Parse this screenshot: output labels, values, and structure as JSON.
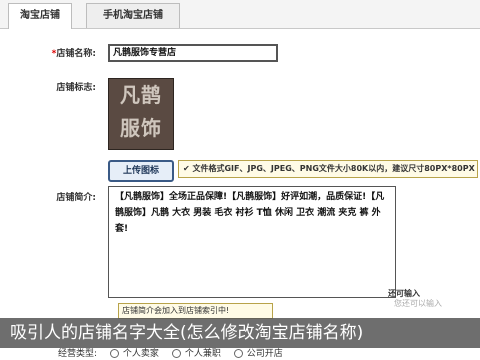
{
  "tabs": [
    {
      "label": "淘宝店铺"
    },
    {
      "label": "手机淘宝店铺"
    }
  ],
  "form": {
    "name_label": "店铺名称:",
    "name_value": "凡鹊服饰专营店",
    "logo_label": "店铺标志:",
    "logo_line1": "凡鹊",
    "logo_line2": "服饰",
    "upload_label": "上传图标",
    "upload_tip": "✔ 文件格式GIF、JPG、JPEG、PNG文件大小80K以内，建议尺寸80PX*80PX",
    "intro_label": "店铺简介:",
    "intro_text": "【凡鹊服饰】全场正品保障!【凡鹊服饰】好评如潮，品质保证!【凡鹊服饰】凡鹊 大衣 男装 毛衣 衬衫 T恤 休闲 卫衣 潮流 夹克 裤 外套!",
    "count_text": "还可输入",
    "hint_text": "您还可以输入",
    "promo_text": "店铺简介会加入到店铺索引中!",
    "type_label": "经营类型:",
    "type_options": [
      "个人卖家",
      "个人兼职",
      "公司开店"
    ]
  },
  "banner": {
    "text": "吸引人的店铺名字大全(怎么修改淘宝店铺名称)"
  }
}
